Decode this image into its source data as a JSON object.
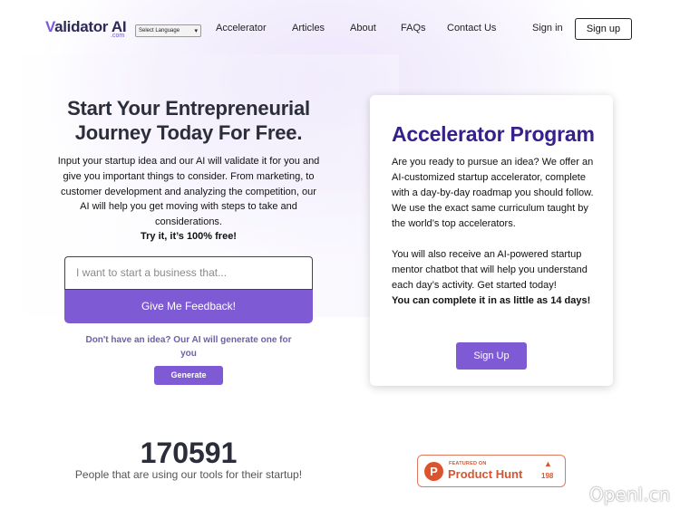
{
  "header": {
    "logo_main": "alidator AI",
    "logo_v": "V",
    "logo_sub": ".com",
    "language_select": "Select Language",
    "nav": [
      "Accelerator",
      "Articles",
      "About",
      "FAQs",
      "Contact Us"
    ],
    "signin_label": "Sign in",
    "signup_label": "Sign up"
  },
  "hero": {
    "title": "Start Your Entrepreneurial Journey Today For Free.",
    "description": "Input your startup idea and our AI will validate it for you and give you important things to consider. From marketing, to customer development and analyzing the competition, our AI will help you get moving with steps to take and considerations.",
    "try_text": "Try it, it’s 100% free!",
    "input_placeholder": "I want to start a business that...",
    "feedback_button": "Give Me Feedback!",
    "no_idea_text": "Don't have an idea? Our AI will generate one for you",
    "generate_button": "Generate"
  },
  "accelerator": {
    "title": "Accelerator Program",
    "para1": "Are you ready to pursue an idea? We offer an AI-customized startup accelerator, complete with a day-by-day roadmap you should follow. We use the exact same curriculum taught by the world’s top accelerators.",
    "para2": "You will also receive an AI-powered startup mentor chatbot that will help you understand each day’s activity. Get started today!",
    "para3": "You can complete it in as little as 14 days!",
    "button": "Sign Up"
  },
  "stats": {
    "count": "170591",
    "label": "People that are using our tools for their startup!"
  },
  "product_hunt": {
    "logo_letter": "P",
    "featured": "FEATURED ON",
    "name": "Product Hunt",
    "arrow": "▲",
    "votes": "198"
  },
  "watermark": "OpenI.cn",
  "colors": {
    "accent": "#7e5bd5",
    "title_dark": "#2b2d3a",
    "card_title": "#37208a",
    "product_hunt": "#da552f"
  }
}
